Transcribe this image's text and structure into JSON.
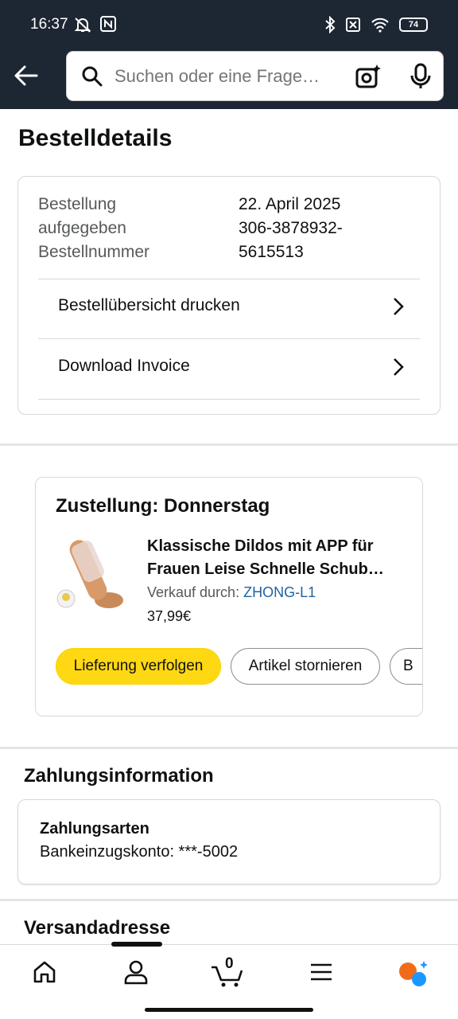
{
  "status": {
    "time": "16:37",
    "battery": "74"
  },
  "search": {
    "placeholder": "Suchen oder eine Frage…"
  },
  "page": {
    "title": "Bestelldetails"
  },
  "order": {
    "placed_label": "Bestellung aufgegeben",
    "placed_label_1": "Bestellung",
    "placed_label_2": "aufgegeben",
    "placed_value": "22. April 2025",
    "number_label": "Bestellnummer",
    "number_value_1": "306-3878932-",
    "number_value_2": "5615513",
    "print_label": "Bestellübersicht drucken",
    "invoice_label": "Download Invoice"
  },
  "shipment": {
    "heading": "Zustellung: Donnerstag",
    "product_title_1": "Klassische Dildos mit APP für",
    "product_title_2": "Frauen Leise Schnelle Schub…",
    "seller_prefix": "Verkauf durch: ",
    "seller_name": "ZHONG-L1",
    "price": "37,99€",
    "track_label": "Lieferung verfolgen",
    "cancel_label": "Artikel stornieren",
    "more_label": "B"
  },
  "payment": {
    "section_title": "Zahlungsinformation",
    "methods_label": "Zahlungsarten",
    "method_value": "Bankeinzugskonto: ***-5002"
  },
  "shipping": {
    "section_title": "Versandadresse"
  },
  "tabbar": {
    "cart_count": "0"
  },
  "colors": {
    "header": "#1d2733",
    "accent_button": "#ffd814",
    "link": "#2162a1"
  }
}
